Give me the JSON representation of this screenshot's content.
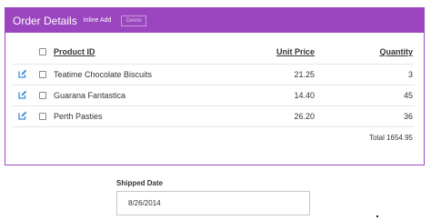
{
  "panel": {
    "title": "Order Details",
    "inline_add": "Inline Add",
    "delete": "Delete"
  },
  "columns": {
    "product": "Product ID",
    "price": "Unit Price",
    "qty": "Quantity"
  },
  "rows": [
    {
      "product": "Teatime Chocolate Biscuits",
      "price": "21.25",
      "qty": "3"
    },
    {
      "product": "Guarana Fantastica",
      "price": "14.40",
      "qty": "45"
    },
    {
      "product": "Perth Pasties",
      "price": "26.20",
      "qty": "36"
    }
  ],
  "total": "Total 1654.95",
  "shipped": {
    "label": "Shipped Date",
    "value": "8/26/2014"
  },
  "colors": {
    "header": "#9b45be",
    "edit_icon": "#3a8ad8"
  },
  "icons": {
    "edit": "edit-icon",
    "checkbox": "checkbox"
  }
}
